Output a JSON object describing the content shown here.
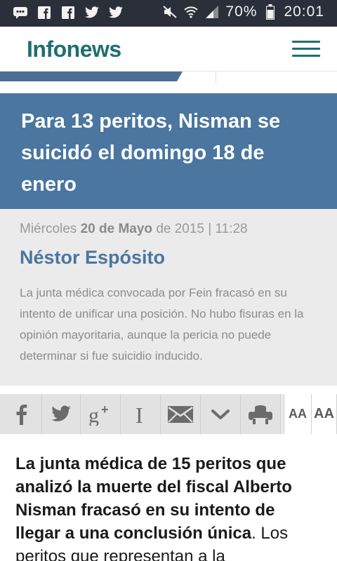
{
  "status_bar": {
    "battery": "70%",
    "time": "20:01",
    "icons": [
      "chat-icon",
      "facebook-icon",
      "facebook-icon",
      "twitter-icon",
      "twitter-icon",
      "mute-icon",
      "wifi-icon",
      "signal-icon",
      "battery-icon"
    ]
  },
  "app": {
    "logo_text": "Infonews",
    "menu_icon": "hamburger-icon"
  },
  "article": {
    "title": "Para 13 peritos, Nisman se suicidó el domingo 18 de enero",
    "date_weekday": "Miércoles",
    "date_day_month": "20 de Mayo",
    "date_year_time": "de 2015 | 11:28",
    "author": "Néstor Espósito",
    "summary": "La junta médica convocada por Fein fracasó en su intento de unificar una posición. No hubo fisuras en la opinión mayoritaria, aunque la pericia no puede determinar si fue suicidio inducido.",
    "body_bold": "La junta médica de 15 peritos que analizó la muerte del fiscal Alberto Nisman fracasó en su intento de llegar a una conclusión única",
    "body_rest": ". Los peritos que representan a la"
  },
  "share_bar": {
    "buttons": [
      "facebook-icon",
      "twitter-icon",
      "google-plus-icon",
      "instapaper-icon",
      "email-icon",
      "more-chevron-icon",
      "read-mode-icon"
    ],
    "font_decrease_label": "AA",
    "font_increase_label": "AA"
  }
}
